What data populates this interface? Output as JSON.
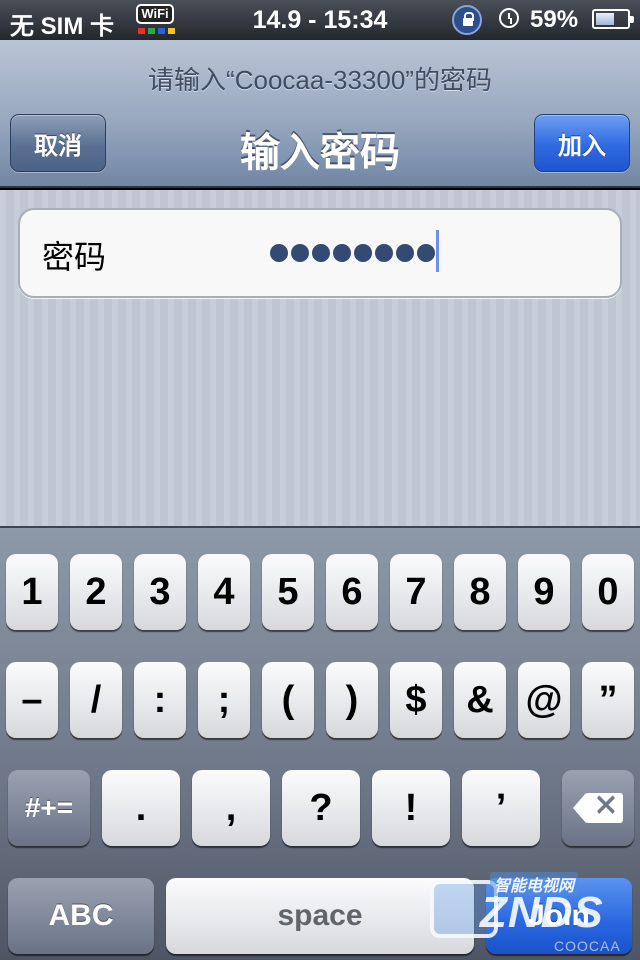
{
  "status_bar": {
    "carrier": "无 SIM 卡",
    "wifi_badge": "WiFi",
    "time": "14.9 - 15:34",
    "battery_percent": "59%",
    "battery_level": 0.59,
    "icons": [
      "wifi-badge-icon",
      "rotation-lock-icon",
      "alarm-icon",
      "battery-icon"
    ]
  },
  "nav": {
    "prompt": "请输入“Coocaa-33300”的密码",
    "title": "输入密码",
    "cancel_label": "取消",
    "join_label": "加入"
  },
  "password_field": {
    "label": "密码",
    "masked_value": "••••••••",
    "char_count": 8
  },
  "keyboard": {
    "row1": [
      "1",
      "2",
      "3",
      "4",
      "5",
      "6",
      "7",
      "8",
      "9",
      "0"
    ],
    "row2": [
      "–",
      "/",
      ":",
      ";",
      "(",
      ")",
      "$",
      "&",
      "@",
      "”"
    ],
    "row3": [
      ".",
      ",",
      "?",
      "!",
      "’"
    ],
    "shift_symbols_label": "#+=",
    "abc_label": "ABC",
    "space_label": "space",
    "join_label": "Join",
    "delete_icon": "backspace-icon"
  },
  "watermark": {
    "brand": "ZNDS",
    "sub": "智能电视网",
    "small": "COOCAA"
  },
  "colors": {
    "nav_gradient_top": "#b9c5d5",
    "join_blue": "#2f6ae2",
    "password_dot": "#344a72"
  }
}
